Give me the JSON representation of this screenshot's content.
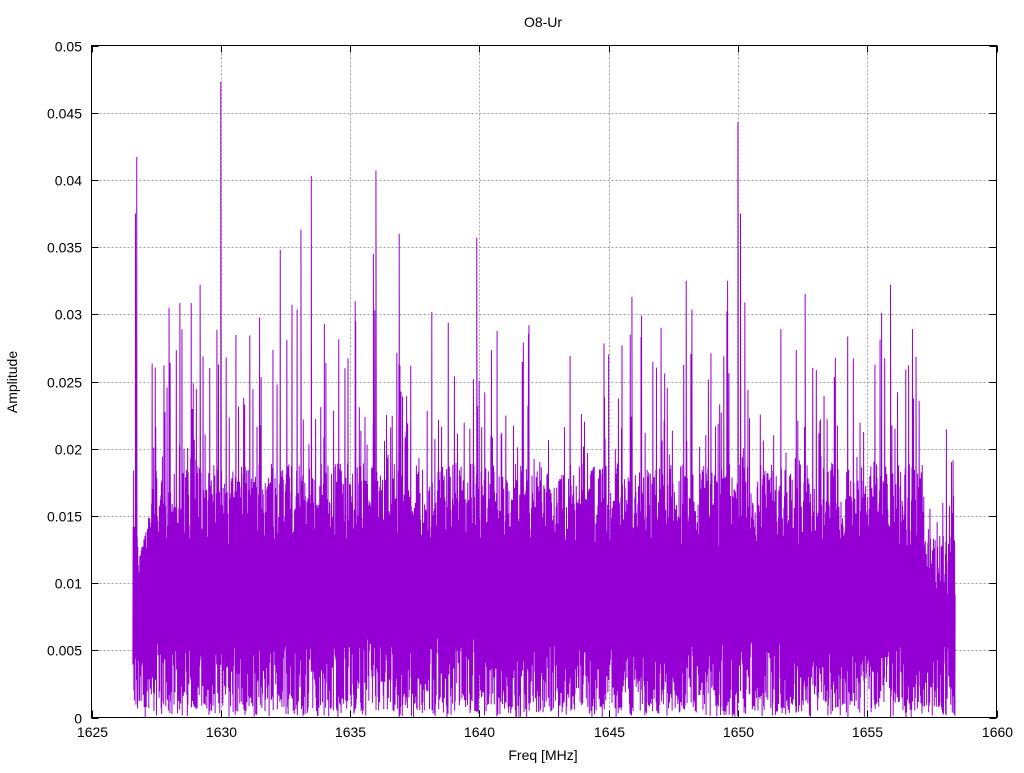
{
  "chart_data": {
    "type": "line",
    "title": "O8-Ur",
    "xlabel": "Freq [MHz]",
    "ylabel": "Amplitude",
    "xlim": [
      1625,
      1660
    ],
    "ylim": [
      0,
      0.05
    ],
    "xticks": [
      "1625",
      "1630",
      "1635",
      "1640",
      "1645",
      "1650",
      "1655",
      "1660"
    ],
    "yticks": [
      "0",
      "0.005",
      "0.01",
      "0.015",
      "0.02",
      "0.025",
      "0.03",
      "0.035",
      "0.04",
      "0.045",
      "0.05"
    ],
    "grid": true,
    "series": [
      {
        "name": "O8-Ur",
        "color": "#9400d3",
        "x_range": [
          1626.6,
          1658.4
        ],
        "typical_floor": 0.003,
        "typical_band_top": 0.018,
        "typical_peak_max": 0.027,
        "peaks": [
          {
            "x": 1626.7,
            "y": 0.0375
          },
          {
            "x": 1626.75,
            "y": 0.0417
          },
          {
            "x": 1628.0,
            "y": 0.0305
          },
          {
            "x": 1629.2,
            "y": 0.0322
          },
          {
            "x": 1630.0,
            "y": 0.0473
          },
          {
            "x": 1632.3,
            "y": 0.0348
          },
          {
            "x": 1633.1,
            "y": 0.0363
          },
          {
            "x": 1633.5,
            "y": 0.0403
          },
          {
            "x": 1635.9,
            "y": 0.0345
          },
          {
            "x": 1636.0,
            "y": 0.0407
          },
          {
            "x": 1636.9,
            "y": 0.036
          },
          {
            "x": 1639.9,
            "y": 0.0357
          },
          {
            "x": 1645.9,
            "y": 0.0313
          },
          {
            "x": 1648.0,
            "y": 0.0325
          },
          {
            "x": 1649.6,
            "y": 0.0325
          },
          {
            "x": 1650.0,
            "y": 0.0443
          },
          {
            "x": 1650.1,
            "y": 0.0375
          },
          {
            "x": 1652.6,
            "y": 0.0315
          },
          {
            "x": 1655.9,
            "y": 0.0322
          },
          {
            "x": 1656.6,
            "y": 0.0262
          }
        ]
      }
    ]
  }
}
